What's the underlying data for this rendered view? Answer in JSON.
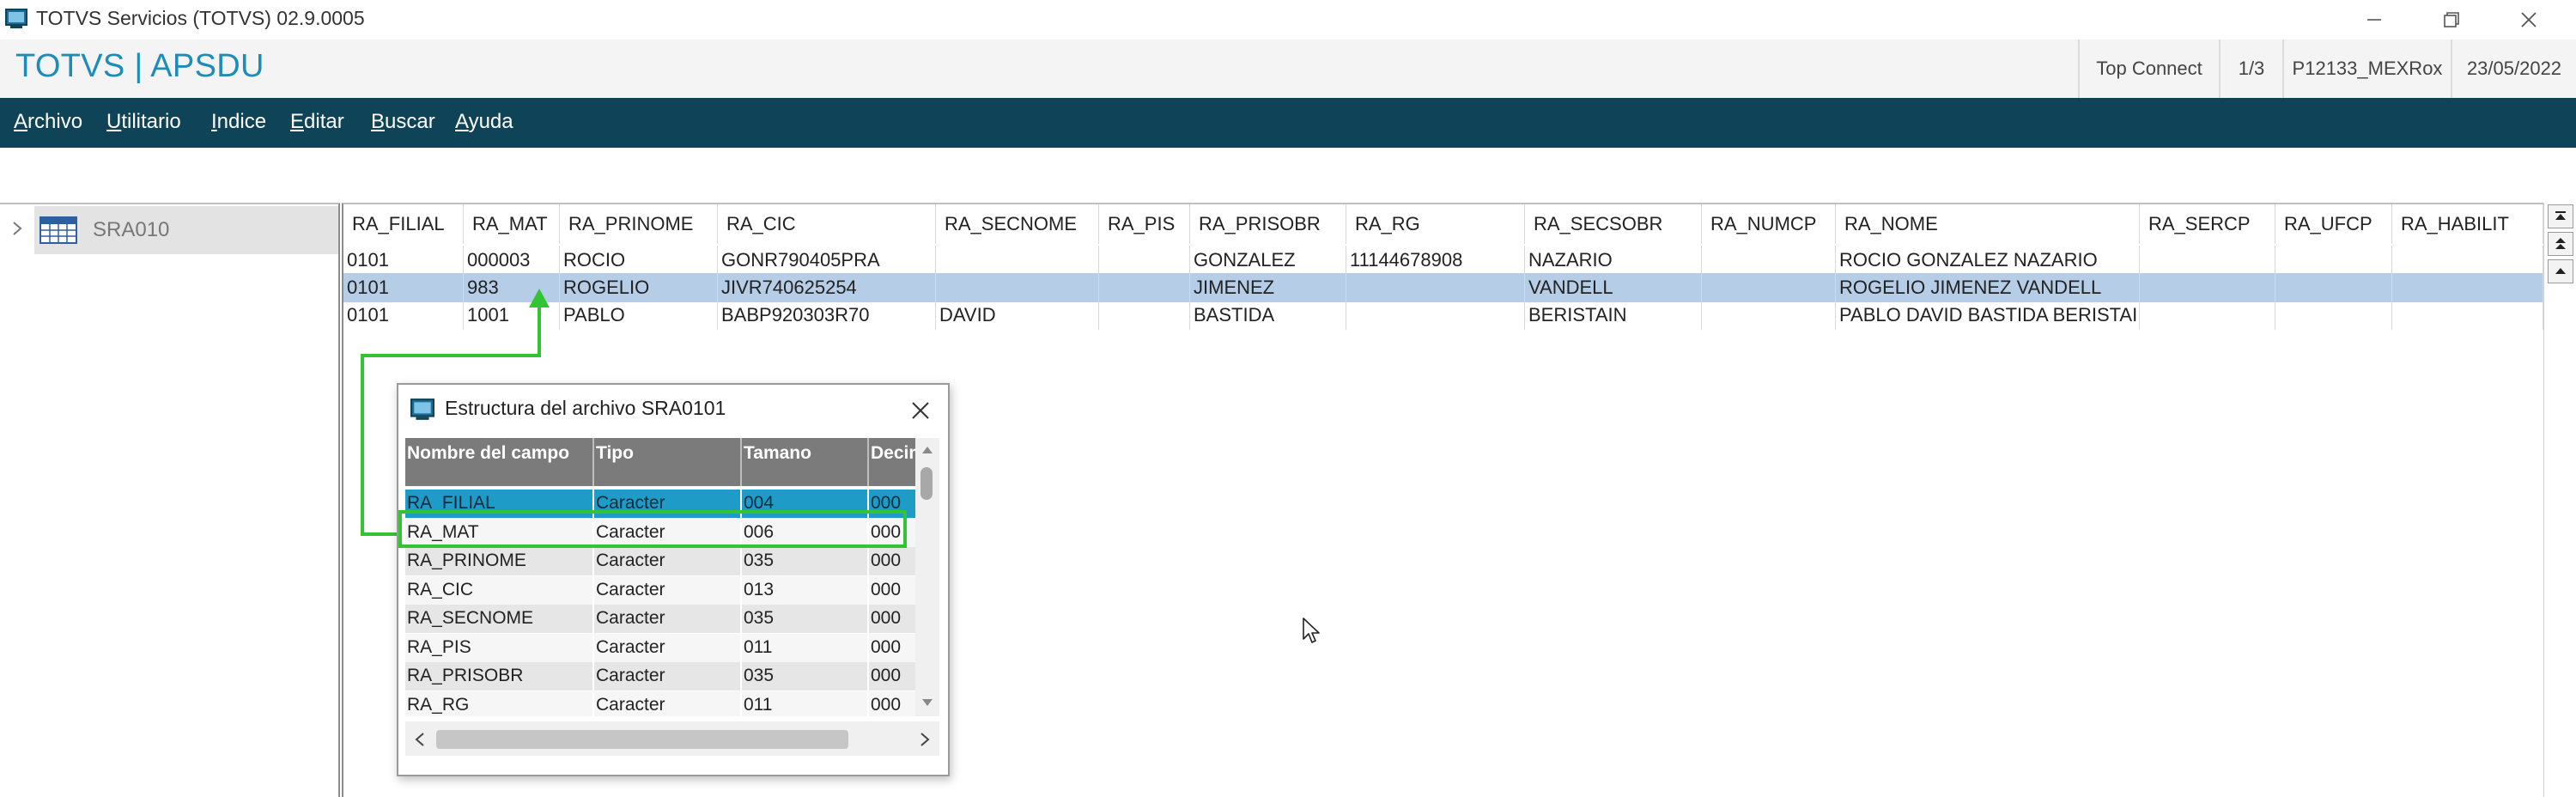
{
  "window": {
    "title": "TOTVS Servicios (TOTVS) 02.9.0005",
    "controls": {
      "minimize": "minimize-icon",
      "restore": "restore-icon",
      "close": "close-icon"
    }
  },
  "brand": {
    "title": "TOTVS | APSDU",
    "status": [
      "Top Connect",
      "1/3",
      "P12133_MEXRox",
      "23/05/2022"
    ]
  },
  "menu": {
    "items": [
      {
        "first": "A",
        "rest": "rchivo"
      },
      {
        "first": "U",
        "rest": "tilitario"
      },
      {
        "first": "I",
        "rest": "ndice"
      },
      {
        "first": "E",
        "rest": "ditar"
      },
      {
        "first": "B",
        "rest": "uscar"
      },
      {
        "first": "A",
        "rest": "yuda"
      }
    ]
  },
  "tree": {
    "items": [
      {
        "label": "SRA010",
        "icon": "table-icon"
      }
    ]
  },
  "grid": {
    "columns": [
      "RA_FILIAL",
      "RA_MAT",
      "RA_PRINOME",
      "RA_CIC",
      "RA_SECNOME",
      "RA_PIS",
      "RA_PRISOBR",
      "RA_RG",
      "RA_SECSOBR",
      "RA_NUMCP",
      "RA_NOME",
      "RA_SERCP",
      "RA_UFCP",
      "RA_HABILIT"
    ],
    "rows": [
      [
        "0101",
        "000003",
        "ROCIO",
        "GONR790405PRA",
        "",
        "",
        "GONZALEZ",
        "11144678908",
        "NAZARIO",
        "",
        "ROCIO  GONZALEZ NAZARIO",
        "",
        "",
        ""
      ],
      [
        "0101",
        "983",
        "ROGELIO",
        "JIVR740625254",
        "",
        "",
        "JIMENEZ",
        "",
        "VANDELL",
        "",
        "ROGELIO  JIMENEZ VANDELL",
        "",
        "",
        ""
      ],
      [
        "0101",
        "1001",
        "PABLO",
        "BABP920303R70",
        "DAVID",
        "",
        "BASTIDA",
        "",
        "BERISTAIN",
        "",
        "PABLO DAVID BASTIDA BERISTAIN",
        "",
        "",
        ""
      ]
    ],
    "selected_row": 1
  },
  "dialog": {
    "title": "Estructura del archivo SRA0101",
    "columns": [
      "Nombre del campo",
      "Tipo",
      "Tamano",
      "Decimal"
    ],
    "rows": [
      [
        "RA_FILIAL",
        "Caracter",
        "004",
        "000"
      ],
      [
        "RA_MAT",
        "Caracter",
        "006",
        "000"
      ],
      [
        "RA_PRINOME",
        "Caracter",
        "035",
        "000"
      ],
      [
        "RA_CIC",
        "Caracter",
        "013",
        "000"
      ],
      [
        "RA_SECNOME",
        "Caracter",
        "035",
        "000"
      ],
      [
        "RA_PIS",
        "Caracter",
        "011",
        "000"
      ],
      [
        "RA_PRISOBR",
        "Caracter",
        "035",
        "000"
      ],
      [
        "RA_RG",
        "Caracter",
        "011",
        "000"
      ]
    ],
    "selected_row": 0,
    "highlighted_row": 1
  },
  "colors": {
    "brand": "#1d8cb8",
    "menubar": "#0f4458",
    "grid_selection": "#b5cde6",
    "dialog_selection": "#1e9bc6",
    "annotation": "#33c433"
  }
}
